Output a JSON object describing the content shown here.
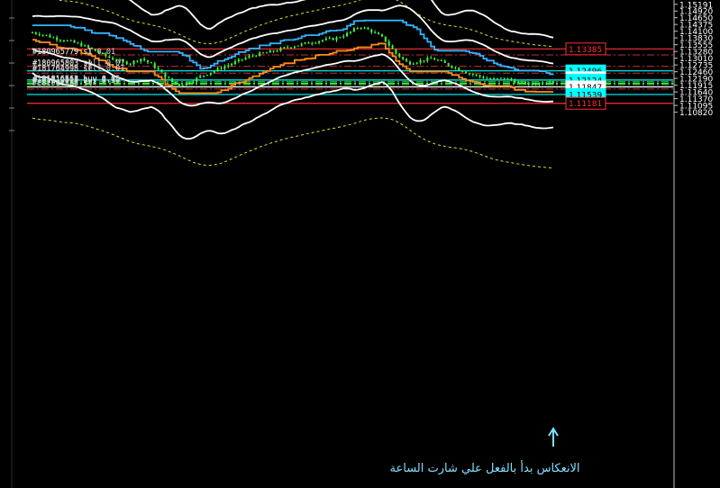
{
  "chart_data": {
    "type": "candlestick",
    "symbol": "EURUSD",
    "ylim": [
      1.1076,
      1.152
    ],
    "y_ticks": [
      "1.15191",
      "1.14920",
      "1.14650",
      "1.14375",
      "1.14100",
      "1.13830",
      "1.13555",
      "1.13280",
      "1.13010",
      "1.12735",
      "1.12460",
      "1.12190",
      "1.11915",
      "1.11640",
      "1.11370",
      "1.11095",
      "1.10820"
    ],
    "price_tags": [
      {
        "value": 1.13385,
        "label": "1.13385",
        "bg": "#000000",
        "fg": "#ff3030",
        "border": "#ff3030"
      },
      {
        "value": 1.12496,
        "label": "1.12496",
        "bg": "#00ffff",
        "fg": "#000000",
        "border": "#00ffff"
      },
      {
        "value": 1.12219,
        "label": "1.12219",
        "bg": "#ffffff",
        "fg": "#000000",
        "border": "#ffffff"
      },
      {
        "value": 1.12124,
        "label": "1.12124",
        "bg": "#00ffff",
        "fg": "#000000",
        "border": "#00ffff"
      },
      {
        "value": 1.11847,
        "label": "1.11847",
        "bg": "#ffffff",
        "fg": "#000000",
        "border": "#ffffff"
      },
      {
        "value": 1.11539,
        "label": "1.11539",
        "bg": "#00ffff",
        "fg": "#000000",
        "border": "#00ffff"
      },
      {
        "value": 1.11181,
        "label": "1.11181",
        "bg": "#000000",
        "fg": "#ff3030",
        "border": "#ff3030"
      }
    ],
    "horizontal_lines": [
      {
        "value": 1.13385,
        "color": "#ff3030",
        "style": "solid"
      },
      {
        "value": 1.1314,
        "color": "#c83030",
        "style": "dashdot"
      },
      {
        "value": 1.1268,
        "color": "#c83030",
        "style": "dashdot"
      },
      {
        "value": 1.12496,
        "color": "#00ffff",
        "style": "solid"
      },
      {
        "value": 1.124,
        "color": "#c83030",
        "style": "dashdot"
      },
      {
        "value": 1.12124,
        "color": "#00ffff",
        "style": "solid"
      },
      {
        "value": 1.1205,
        "color": "#3cff3c",
        "style": "dashdot"
      },
      {
        "value": 1.1199,
        "color": "#3cff3c",
        "style": "dashdot"
      },
      {
        "value": 1.1194,
        "color": "#3cff3c",
        "style": "dashdot"
      },
      {
        "value": 1.11847,
        "color": "#ffffff",
        "style": "solid"
      },
      {
        "value": 1.1176,
        "color": "#c83030",
        "style": "dashdot"
      },
      {
        "value": 1.11539,
        "color": "#00ffff",
        "style": "solid"
      },
      {
        "value": 1.11181,
        "color": "#ff3030",
        "style": "solid"
      }
    ],
    "order_labels": [
      {
        "value": 1.1314,
        "text": "#180965779 sl"
      },
      {
        "value": 1.1315,
        "text": "#180965779 s1 0.01"
      },
      {
        "value": 1.1268,
        "text": "#180965803 sell 0.01"
      },
      {
        "value": 1.1266,
        "text": "#180965803 sl"
      },
      {
        "value": 1.1246,
        "text": "#181764998 sell 0.01"
      },
      {
        "value": 1.1244,
        "text": "#181764998 sl"
      },
      {
        "value": 1.1205,
        "text": "#181816563 buy 0.05"
      },
      {
        "value": 1.1203,
        "text": "#181816563 buy 0.05"
      },
      {
        "value": 1.1199,
        "text": "#181819518 buy 0.30"
      },
      {
        "value": 1.1197,
        "text": "#181819518 buy 0.30"
      },
      {
        "value": 1.1186,
        "text": "#181910568 sl"
      }
    ],
    "annotation": "الانعكاس بدأ بالفعل علي شارت الساعة",
    "close_price": [
      1.1405,
      1.1395,
      1.138,
      1.137,
      1.1355,
      1.1335,
      1.131,
      1.129,
      1.128,
      1.13,
      1.127,
      1.1225,
      1.119,
      1.1205,
      1.123,
      1.125,
      1.127,
      1.129,
      1.131,
      1.132,
      1.133,
      1.1345,
      1.1355,
      1.1365,
      1.1375,
      1.138,
      1.14,
      1.143,
      1.141,
      1.138,
      1.132,
      1.128,
      1.129,
      1.13,
      1.128,
      1.126,
      1.124,
      1.1225,
      1.1215,
      1.122,
      1.1205,
      1.1195,
      1.12,
      1.121
    ],
    "colors": {
      "background": "#000000",
      "candle": "#3cff3c",
      "bollinger_outer": "#ffffff",
      "envelope": "#e8e020",
      "channel_upper": "#32b4ff",
      "channel_lower": "#ff8c1a",
      "axis": "#c0c0c0"
    }
  }
}
